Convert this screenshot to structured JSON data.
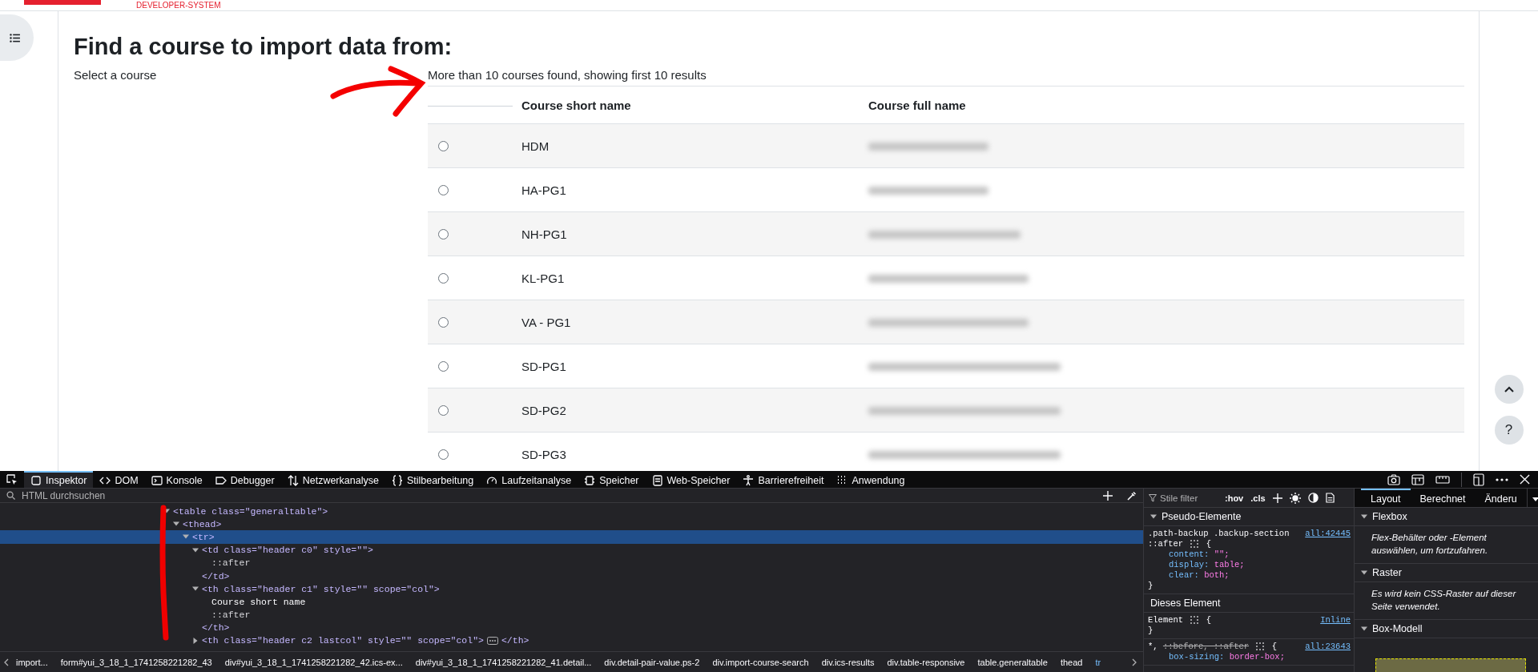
{
  "site": {
    "subtitle": "DEVELOPER-SYSTEM"
  },
  "page": {
    "heading": "Find a course to import data from:",
    "label": "Select a course",
    "result_info": "More than 10 courses found, showing first 10 results",
    "columns": [
      "Course short name",
      "Course full name"
    ],
    "rows": [
      {
        "short_name": "HDM",
        "selected": false
      },
      {
        "short_name": "HA-PG1",
        "selected": false
      },
      {
        "short_name": "NH-PG1",
        "selected": false
      },
      {
        "short_name": "KL-PG1",
        "selected": false
      },
      {
        "short_name": "VA - PG1",
        "selected": false
      },
      {
        "short_name": "SD-PG1",
        "selected": false
      },
      {
        "short_name": "SD-PG2",
        "selected": false
      },
      {
        "short_name": "SD-PG3",
        "selected": false
      }
    ],
    "floating_buttons": [
      {
        "kind": "up"
      },
      {
        "kind": "help",
        "label": "?"
      }
    ]
  },
  "devtools": {
    "tabs": [
      {
        "label": "Inspektor",
        "selected": true
      },
      {
        "label": "DOM",
        "selected": false
      },
      {
        "label": "Konsole",
        "selected": false
      },
      {
        "label": "Debugger",
        "selected": false
      },
      {
        "label": "Netzwerkanalyse",
        "selected": false
      },
      {
        "label": "Stilbearbeitung",
        "selected": false
      },
      {
        "label": "Laufzeitanalyse",
        "selected": false
      },
      {
        "label": "Speicher",
        "selected": false
      },
      {
        "label": "Web-Speicher",
        "selected": false
      },
      {
        "label": "Barrierefreiheit",
        "selected": false
      },
      {
        "label": "Anwendung",
        "selected": false
      }
    ],
    "search": {
      "placeholder": "HTML durchsuchen"
    },
    "tree": [
      {
        "kind": "tag",
        "text": "<table class=\"generaltable\">",
        "expanded": true,
        "selected": false,
        "children": [
          {
            "kind": "tag",
            "text": "<thead>",
            "expanded": true,
            "selected": false,
            "children": [
              {
                "kind": "tag",
                "text": "<tr>",
                "expanded": true,
                "selected": true,
                "children": [
                  {
                    "kind": "tag",
                    "text": "<td class=\"header c0\" style=\"\">",
                    "expanded": true,
                    "selected": false,
                    "close": "</td>",
                    "children": [
                      {
                        "kind": "pseudo",
                        "text": "::after"
                      }
                    ]
                  },
                  {
                    "kind": "tag",
                    "text": "<th class=\"header c1\" style=\"\" scope=\"col\">",
                    "expanded": true,
                    "selected": false,
                    "close": "</th>",
                    "children": [
                      {
                        "kind": "text",
                        "text": "Course short name"
                      },
                      {
                        "kind": "pseudo",
                        "text": "::after"
                      }
                    ]
                  },
                  {
                    "kind": "tag",
                    "text": "<th class=\"header c2 lastcol\" style=\"\" scope=\"col\">",
                    "expanded": false,
                    "selected": false,
                    "close": "</th>"
                  }
                ]
              }
            ]
          }
        ]
      }
    ],
    "breadcrumbs": [
      {
        "label": "import...",
        "selected": false
      },
      {
        "label": "form#yui_3_18_1_1741258221282_43",
        "selected": false
      },
      {
        "label": "div#yui_3_18_1_1741258221282_42.ics-ex...",
        "selected": false
      },
      {
        "label": "div#yui_3_18_1_1741258221282_41.detail...",
        "selected": false
      },
      {
        "label": "div.detail-pair-value.ps-2",
        "selected": false
      },
      {
        "label": "div.import-course-search",
        "selected": false
      },
      {
        "label": "div.ics-results",
        "selected": false
      },
      {
        "label": "div.table-responsive",
        "selected": false
      },
      {
        "label": "table.generaltable",
        "selected": false
      },
      {
        "label": "thead",
        "selected": false
      },
      {
        "label": "tr",
        "selected": true
      }
    ],
    "styles": {
      "filter_placeholder": "Stile filter",
      "buttons": [
        ":hov",
        ".cls"
      ],
      "sections": [
        {
          "title": "Pseudo-Elemente",
          "expanded": true,
          "rules": [
            {
              "selector": [
                {
                  "text": ".path-backup .backup-section",
                  "struck": false
                },
                {
                  "text": "::after",
                  "struck": false
                }
              ],
              "open": "{",
              "source": "all:42445",
              "declarations": [
                {
                  "property": "content:",
                  "value": "\"\";"
                },
                {
                  "property": "display:",
                  "value": "table;"
                },
                {
                  "property": "clear:",
                  "value": "both;"
                }
              ],
              "close": "}"
            }
          ]
        },
        {
          "title": "Dieses Element",
          "rules": [
            {
              "selector": [
                {
                  "text": "Element",
                  "struck": false
                }
              ],
              "open": "{",
              "source": "Inline",
              "close": "}"
            },
            {
              "selector": [
                {
                  "text": "*,",
                  "struck": false
                },
                {
                  "text": "::before, ::after",
                  "struck": true
                }
              ],
              "open": "{",
              "source": "all:23643",
              "declarations": [
                {
                  "property": "box-sizing:",
                  "value": "border-box;"
                }
              ]
            }
          ]
        }
      ]
    },
    "layout": {
      "tabs": [
        {
          "label": "Layout",
          "selected": true
        },
        {
          "label": "Berechnet",
          "selected": false
        },
        {
          "label": "Änderu",
          "selected": false
        }
      ],
      "sections": [
        {
          "title": "Flexbox",
          "expanded": true,
          "kind": "message",
          "text": "Flex-Behälter oder -Element auswählen, um fortzufahren."
        },
        {
          "title": "Raster",
          "expanded": true,
          "kind": "message",
          "text": "Es wird kein CSS-Raster auf dieser Seite verwendet."
        },
        {
          "title": "Box-Modell",
          "expanded": true,
          "kind": "box-model"
        }
      ]
    }
  }
}
